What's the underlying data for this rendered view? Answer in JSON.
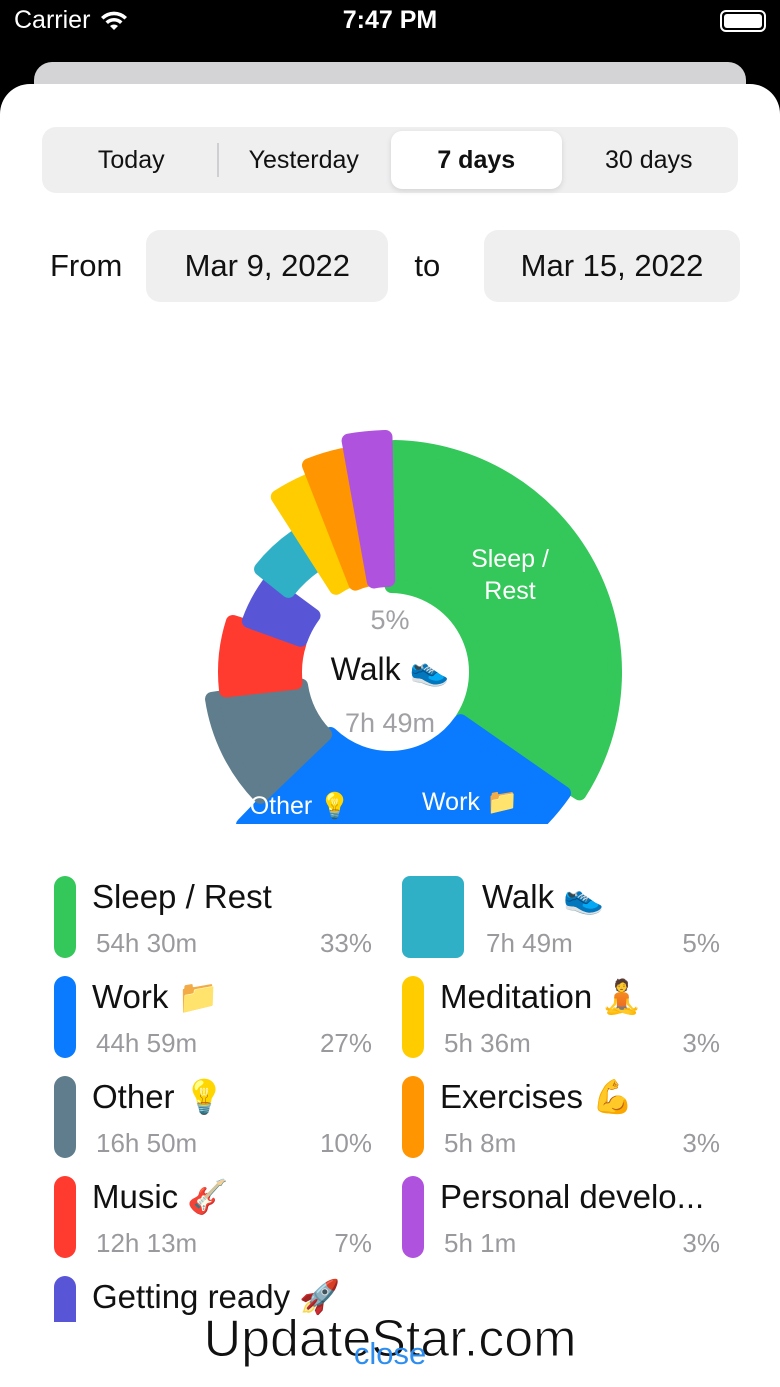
{
  "status_bar": {
    "carrier": "Carrier",
    "time": "7:47 PM"
  },
  "segments": [
    {
      "label": "Today",
      "selected": false
    },
    {
      "label": "Yesterday",
      "selected": false
    },
    {
      "label": "7 days",
      "selected": true
    },
    {
      "label": "30 days",
      "selected": false
    }
  ],
  "date_range": {
    "from_label": "From",
    "from_value": "Mar 9, 2022",
    "to_label": "to",
    "to_value": "Mar 15, 2022"
  },
  "chart_center": {
    "percent": "5%",
    "title": "Walk 👟",
    "duration": "7h 49m"
  },
  "chart_labels": {
    "sleep": [
      "Sleep /",
      "Rest"
    ],
    "work": "Work 📁",
    "other": "Other 💡"
  },
  "watermark": "UpdateStar.com",
  "chart_data": {
    "type": "pie",
    "categories": [
      "Sleep / Rest",
      "Work",
      "Other",
      "Music",
      "Getting ready",
      "Walk",
      "Meditation",
      "Exercises",
      "Personal develo..."
    ],
    "values": [
      33,
      27,
      10,
      7,
      5,
      5,
      3,
      3,
      3
    ],
    "selected": "Walk"
  },
  "legend": [
    {
      "title": "Sleep / Rest",
      "time": "54h 30m",
      "pct": "33%",
      "color": "#34c759"
    },
    {
      "title": "Work 📁",
      "time": "44h 59m",
      "pct": "27%",
      "color": "#0a7aff"
    },
    {
      "title": "Other 💡",
      "time": "16h 50m",
      "pct": "10%",
      "color": "#5f7d8c"
    },
    {
      "title": "Music 🎸",
      "time": "12h 13m",
      "pct": "7%",
      "color": "#ff3b30"
    },
    {
      "title": "Getting ready 🚀",
      "time": "",
      "pct": "",
      "color": "#5856d6"
    },
    {
      "title": "Walk 👟",
      "time": "7h 49m",
      "pct": "5%",
      "color": "#30b0c7"
    },
    {
      "title": "Meditation 🧘",
      "time": "5h 36m",
      "pct": "3%",
      "color": "#ffcc00"
    },
    {
      "title": "Exercises 💪",
      "time": "5h 8m",
      "pct": "3%",
      "color": "#ff9500"
    },
    {
      "title": "Personal develo...",
      "time": "5h 1m",
      "pct": "3%",
      "color": "#af52de"
    }
  ],
  "close_label": "close"
}
